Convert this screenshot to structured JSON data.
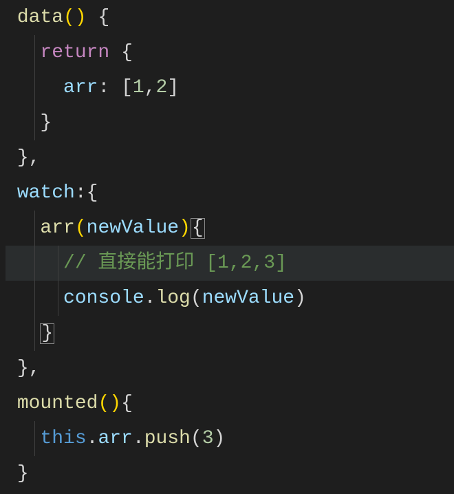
{
  "editor": {
    "lang": "javascript",
    "lines": {
      "l1_data": "data",
      "l2_return": "return",
      "l3_arr": "arr",
      "l3_values": "[1,2]",
      "l5_watch": "watch",
      "l6_arr": "arr",
      "l6_param": "newValue",
      "l7_comment": "// 直接能打印 [1,2,3]",
      "l8_console": "console",
      "l8_log": "log",
      "l8_arg": "newValue",
      "l11_mounted": "mounted",
      "l12_this": "this",
      "l12_arr": "arr",
      "l12_push": "push",
      "l12_arg": "3"
    }
  }
}
